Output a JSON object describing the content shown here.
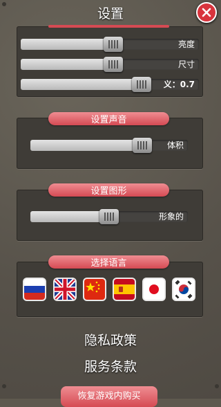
{
  "header": {
    "title": "设置"
  },
  "display_sliders": [
    {
      "label": "亮度",
      "value": 0.52
    },
    {
      "label": "尺寸",
      "value": 0.52
    },
    {
      "label": "义：0.7",
      "value": 0.68
    }
  ],
  "sound": {
    "title": "设置声音",
    "slider": {
      "label": "体积",
      "value": 0.71
    }
  },
  "graphics": {
    "title": "设置图形",
    "slider": {
      "label": "形象的",
      "value": 0.5
    }
  },
  "language": {
    "title": "选择语言",
    "flags": [
      "russia-flag-icon",
      "uk-flag-icon",
      "china-flag-icon",
      "spain-flag-icon",
      "japan-flag-icon",
      "korea-flag-icon"
    ]
  },
  "links": {
    "privacy": "隐私政策",
    "terms": "服务条款"
  },
  "bottom_button": {
    "label": "恢复游戏内购买"
  },
  "colors": {
    "accent": "#d54a53",
    "panel": "#3f3c37",
    "background": "#5e594f"
  }
}
